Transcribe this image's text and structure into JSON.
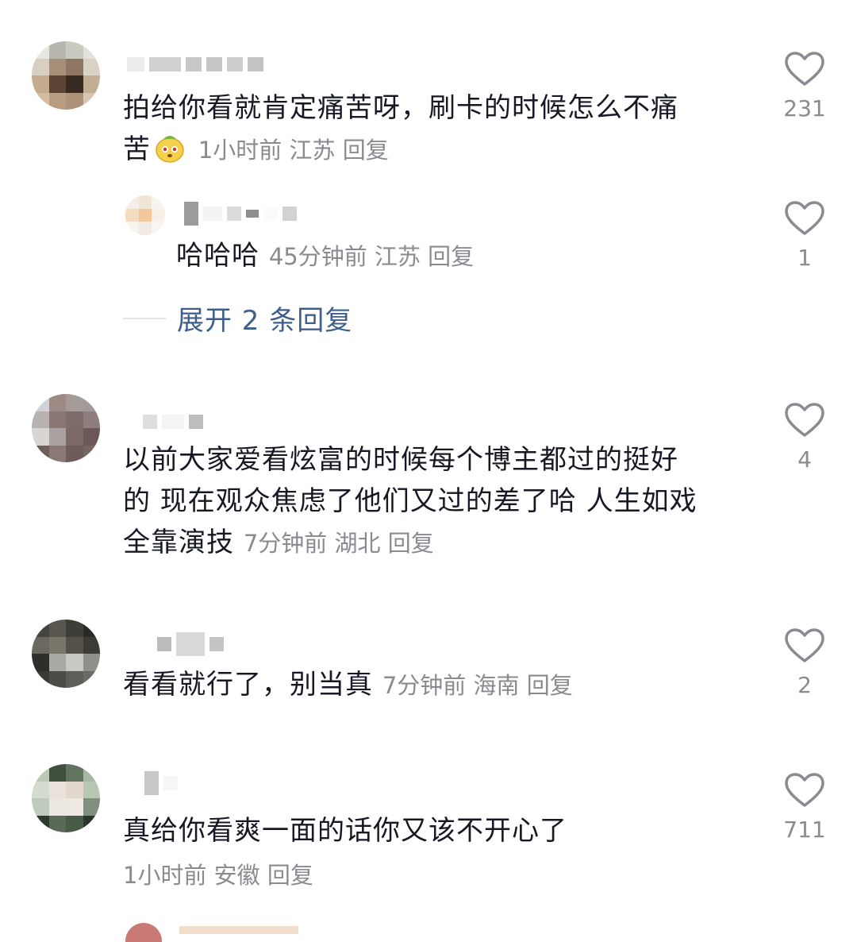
{
  "comments": [
    {
      "text": "拍给你看就肯定痛苦呀，刷卡的时候怎么不痛苦",
      "text_line1": "拍给你看就肯定痛苦呀，刷卡的时候怎么不痛",
      "text_line2": "苦",
      "emoji": "yellow-face-emoji",
      "time": "1小时前",
      "location": "江苏",
      "reply_label": "回复",
      "likes": "231",
      "replies": [
        {
          "text": "哈哈哈",
          "time": "45分钟前",
          "location": "江苏",
          "reply_label": "回复",
          "likes": "1"
        }
      ],
      "expand_label": "展开 2 条回复"
    },
    {
      "text_line1": "以前大家爱看炫富的时候每个博主都过的挺好",
      "text_line2": "的 现在观众焦虑了他们又过的差了哈 人生如戏",
      "text_line3": "全靠演技",
      "time": "7分钟前",
      "location": "湖北",
      "reply_label": "回复",
      "likes": "4"
    },
    {
      "text": "看看就行了，别当真",
      "time": "7分钟前",
      "location": "海南",
      "reply_label": "回复",
      "likes": "2"
    },
    {
      "text": "真给你看爽一面的话你又该不开心了",
      "time": "1小时前",
      "location": "安徽",
      "reply_label": "回复",
      "likes": "711"
    }
  ],
  "icons": {
    "like": "heart-outline-icon"
  },
  "colors": {
    "text": "#161823",
    "meta": "#8a8b91",
    "expand": "#3e5f8a",
    "heart": "#8a8b91"
  }
}
